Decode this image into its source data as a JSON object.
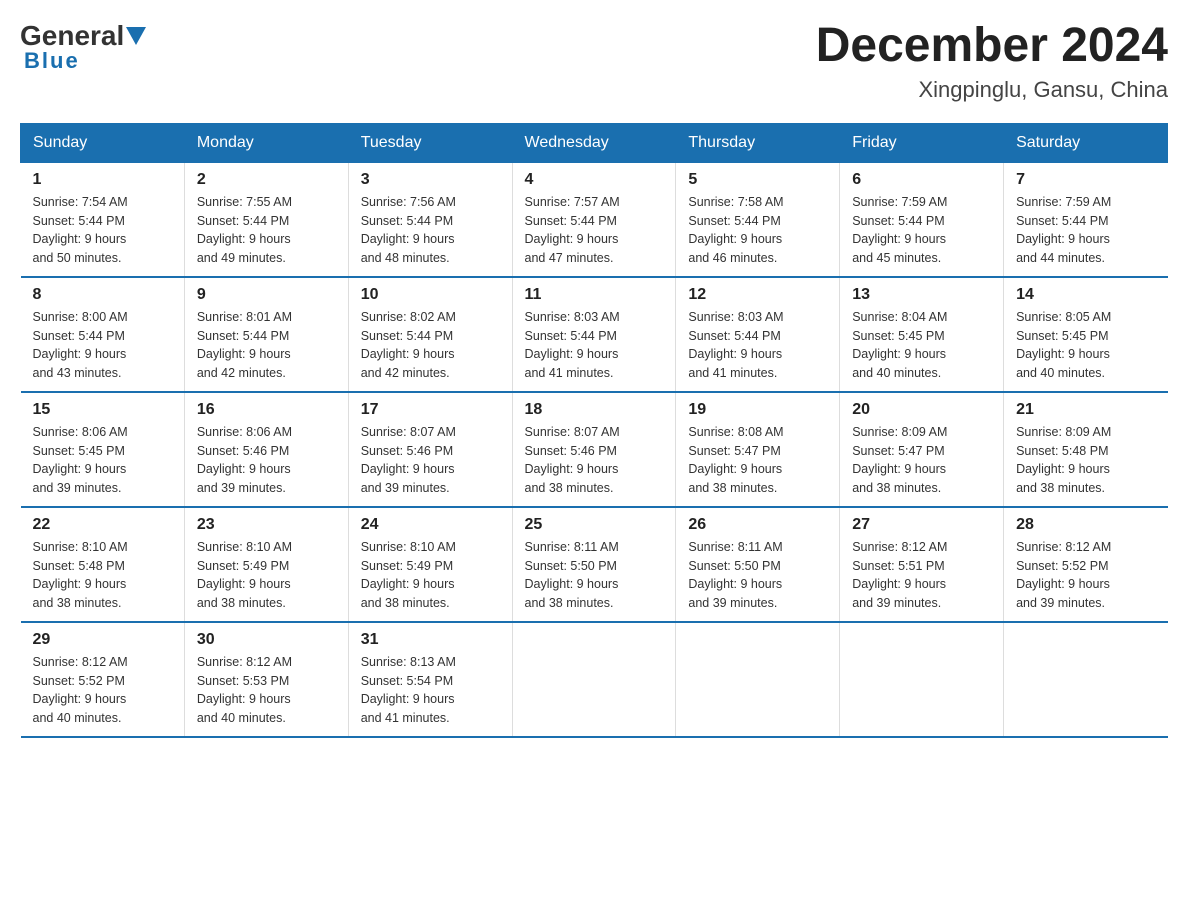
{
  "header": {
    "logo_general": "General",
    "logo_blue": "Blue",
    "month_title": "December 2024",
    "location": "Xingpinglu, Gansu, China"
  },
  "weekdays": [
    "Sunday",
    "Monday",
    "Tuesday",
    "Wednesday",
    "Thursday",
    "Friday",
    "Saturday"
  ],
  "weeks": [
    [
      {
        "day": "1",
        "sunrise": "7:54 AM",
        "sunset": "5:44 PM",
        "daylight": "9 hours and 50 minutes."
      },
      {
        "day": "2",
        "sunrise": "7:55 AM",
        "sunset": "5:44 PM",
        "daylight": "9 hours and 49 minutes."
      },
      {
        "day": "3",
        "sunrise": "7:56 AM",
        "sunset": "5:44 PM",
        "daylight": "9 hours and 48 minutes."
      },
      {
        "day": "4",
        "sunrise": "7:57 AM",
        "sunset": "5:44 PM",
        "daylight": "9 hours and 47 minutes."
      },
      {
        "day": "5",
        "sunrise": "7:58 AM",
        "sunset": "5:44 PM",
        "daylight": "9 hours and 46 minutes."
      },
      {
        "day": "6",
        "sunrise": "7:59 AM",
        "sunset": "5:44 PM",
        "daylight": "9 hours and 45 minutes."
      },
      {
        "day": "7",
        "sunrise": "7:59 AM",
        "sunset": "5:44 PM",
        "daylight": "9 hours and 44 minutes."
      }
    ],
    [
      {
        "day": "8",
        "sunrise": "8:00 AM",
        "sunset": "5:44 PM",
        "daylight": "9 hours and 43 minutes."
      },
      {
        "day": "9",
        "sunrise": "8:01 AM",
        "sunset": "5:44 PM",
        "daylight": "9 hours and 42 minutes."
      },
      {
        "day": "10",
        "sunrise": "8:02 AM",
        "sunset": "5:44 PM",
        "daylight": "9 hours and 42 minutes."
      },
      {
        "day": "11",
        "sunrise": "8:03 AM",
        "sunset": "5:44 PM",
        "daylight": "9 hours and 41 minutes."
      },
      {
        "day": "12",
        "sunrise": "8:03 AM",
        "sunset": "5:44 PM",
        "daylight": "9 hours and 41 minutes."
      },
      {
        "day": "13",
        "sunrise": "8:04 AM",
        "sunset": "5:45 PM",
        "daylight": "9 hours and 40 minutes."
      },
      {
        "day": "14",
        "sunrise": "8:05 AM",
        "sunset": "5:45 PM",
        "daylight": "9 hours and 40 minutes."
      }
    ],
    [
      {
        "day": "15",
        "sunrise": "8:06 AM",
        "sunset": "5:45 PM",
        "daylight": "9 hours and 39 minutes."
      },
      {
        "day": "16",
        "sunrise": "8:06 AM",
        "sunset": "5:46 PM",
        "daylight": "9 hours and 39 minutes."
      },
      {
        "day": "17",
        "sunrise": "8:07 AM",
        "sunset": "5:46 PM",
        "daylight": "9 hours and 39 minutes."
      },
      {
        "day": "18",
        "sunrise": "8:07 AM",
        "sunset": "5:46 PM",
        "daylight": "9 hours and 38 minutes."
      },
      {
        "day": "19",
        "sunrise": "8:08 AM",
        "sunset": "5:47 PM",
        "daylight": "9 hours and 38 minutes."
      },
      {
        "day": "20",
        "sunrise": "8:09 AM",
        "sunset": "5:47 PM",
        "daylight": "9 hours and 38 minutes."
      },
      {
        "day": "21",
        "sunrise": "8:09 AM",
        "sunset": "5:48 PM",
        "daylight": "9 hours and 38 minutes."
      }
    ],
    [
      {
        "day": "22",
        "sunrise": "8:10 AM",
        "sunset": "5:48 PM",
        "daylight": "9 hours and 38 minutes."
      },
      {
        "day": "23",
        "sunrise": "8:10 AM",
        "sunset": "5:49 PM",
        "daylight": "9 hours and 38 minutes."
      },
      {
        "day": "24",
        "sunrise": "8:10 AM",
        "sunset": "5:49 PM",
        "daylight": "9 hours and 38 minutes."
      },
      {
        "day": "25",
        "sunrise": "8:11 AM",
        "sunset": "5:50 PM",
        "daylight": "9 hours and 38 minutes."
      },
      {
        "day": "26",
        "sunrise": "8:11 AM",
        "sunset": "5:50 PM",
        "daylight": "9 hours and 39 minutes."
      },
      {
        "day": "27",
        "sunrise": "8:12 AM",
        "sunset": "5:51 PM",
        "daylight": "9 hours and 39 minutes."
      },
      {
        "day": "28",
        "sunrise": "8:12 AM",
        "sunset": "5:52 PM",
        "daylight": "9 hours and 39 minutes."
      }
    ],
    [
      {
        "day": "29",
        "sunrise": "8:12 AM",
        "sunset": "5:52 PM",
        "daylight": "9 hours and 40 minutes."
      },
      {
        "day": "30",
        "sunrise": "8:12 AM",
        "sunset": "5:53 PM",
        "daylight": "9 hours and 40 minutes."
      },
      {
        "day": "31",
        "sunrise": "8:13 AM",
        "sunset": "5:54 PM",
        "daylight": "9 hours and 41 minutes."
      },
      null,
      null,
      null,
      null
    ]
  ],
  "labels": {
    "sunrise": "Sunrise:",
    "sunset": "Sunset:",
    "daylight": "Daylight:"
  }
}
